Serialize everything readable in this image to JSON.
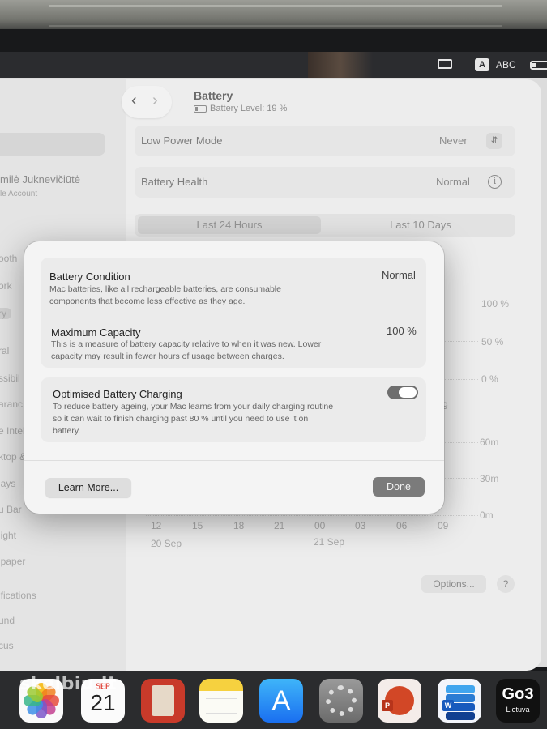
{
  "menubar": {
    "input_badge": "A",
    "input_source": "ABC"
  },
  "window": {
    "title": "Battery",
    "battery_level": "Battery Level: 19 %"
  },
  "sidebar": {
    "user_name": "milė Juknevičiūtė",
    "user_sub": "le Account",
    "items": [
      "ooth",
      "ork",
      "ry",
      "ral",
      "ssibil",
      "aranc",
      "e Intel",
      "ktop &",
      "lays",
      "u Bar",
      "light",
      "lpaper",
      "ifications",
      "und",
      "cus"
    ]
  },
  "settings": {
    "low_power_label": "Low Power Mode",
    "low_power_value": "Never",
    "health_label": "Battery Health",
    "health_value": "Normal",
    "tab_24h": "Last 24 Hours",
    "tab_10d": "Last 10 Days",
    "level_axis": [
      "100 %",
      "50 %",
      "0 %"
    ],
    "time_axis": [
      "60m",
      "30m",
      "0m"
    ],
    "hour_labels": [
      "12",
      "15",
      "18",
      "21",
      "00",
      "03",
      "06",
      "09"
    ],
    "date_labels": [
      "20 Sep",
      "21 Sep"
    ],
    "partial_label": "9",
    "options_label": "Options...",
    "help_label": "?"
  },
  "dialog": {
    "condition_title": "Battery Condition",
    "condition_value": "Normal",
    "condition_desc_1": "Mac batteries, like all rechargeable batteries, are consumable",
    "condition_desc_2": "components that become less effective as they age.",
    "capacity_title": "Maximum Capacity",
    "capacity_value": "100 %",
    "capacity_desc_1": "This is a measure of battery capacity relative to when it was new. Lower",
    "capacity_desc_2": "capacity may result in fewer hours of usage between charges.",
    "optimised_title": "Optimised Battery Charging",
    "optimised_desc_1": "To reduce battery ageing, your Mac learns from your daily charging routine",
    "optimised_desc_2": "so it can wait to finish charging past 80 % until you need to use it on",
    "optimised_desc_3": "battery.",
    "optimised_on": true,
    "learn_more_label": "Learn More...",
    "done_label": "Done"
  },
  "dock": {
    "calendar_month": "SEP",
    "calendar_day": "21",
    "go3_title": "Go3",
    "go3_sub": "Lietuva",
    "ppt_letter": "P",
    "word_letter": "W",
    "appstore_glyph": "A"
  },
  "watermark": "skelbiu.lt"
}
